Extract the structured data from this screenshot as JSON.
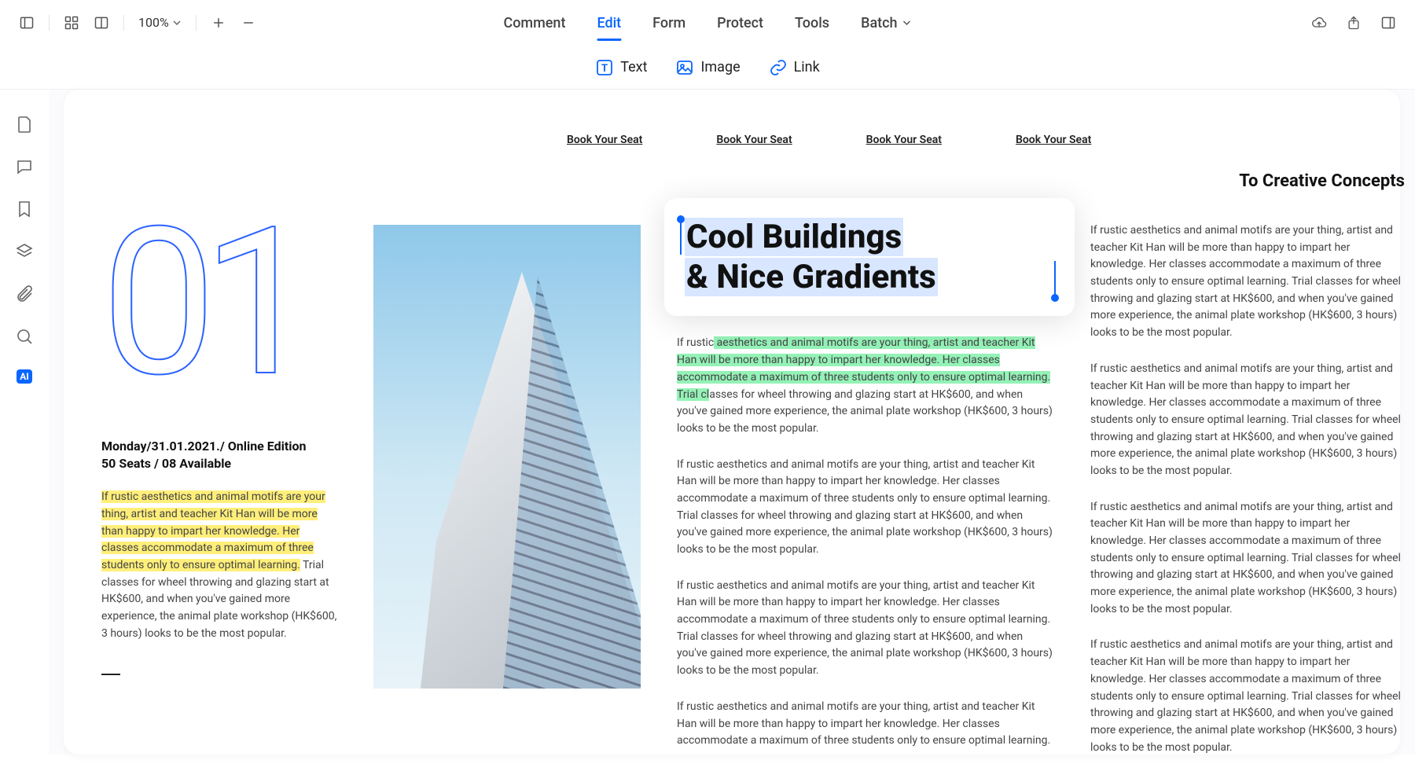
{
  "topbar": {
    "zoom": "100%",
    "tabs": {
      "comment": "Comment",
      "edit": "Edit",
      "form": "Form",
      "protect": "Protect",
      "tools": "Tools",
      "batch": "Batch"
    }
  },
  "subtoolbar": {
    "text": "Text",
    "image": "Image",
    "link": "Link"
  },
  "rail": {
    "ai": "AI"
  },
  "page": {
    "book_link": "Book Your Seat",
    "big_number": "01",
    "date_line1": "Monday/31.01.2021./ Online Edition",
    "date_line2": "50 Seats / 08 Available",
    "col1_body_hl": "If rustic aesthetics and animal motifs are your thing, artist and teacher Kit Han will be more than happy to impart her knowledge. Her classes accommodate a maximum of three students only to ensure optimal learning.",
    "col1_body_rest": " Trial classes for wheel throwing and glazing start at HK$600, and when you've gained more experience, the animal plate workshop (HK$600, 3 hours) looks to be the most popular.",
    "title_line1": "Cool Buildings",
    "title_line2": "& Nice Gradients",
    "col3_p1_prefix": "If rustic",
    "col3_p1_hl": " aesthetics and animal motifs are your thing, artist and teacher Kit Han will be more than happy to impart her knowledge. Her classes accommodate a maximum of three students only to ensure optimal learning. Trial cl",
    "col3_p1_suffix": "asses for wheel throwing and glazing start at HK$600, and when you've gained more experience, the animal plate workshop (HK$600, 3 hours) looks to be the most popular.",
    "para_full": "If rustic aesthetics and animal motifs are your thing, artist and teacher Kit Han will be more than happy to impart her knowledge. Her classes accommodate a maximum of three students only to ensure optimal learning. Trial classes for wheel throwing and glazing start at HK$600, and when you've gained more experience, the animal plate workshop (HK$600, 3 hours) looks to be the most popular.",
    "para_short": "If rustic aesthetics and animal motifs are your thing, artist and teacher Kit Han will be more than happy to impart her knowledge. Her classes accommodate a maximum of three students only to ensure optimal learning.",
    "concepts_title": "To Creative Concepts"
  }
}
